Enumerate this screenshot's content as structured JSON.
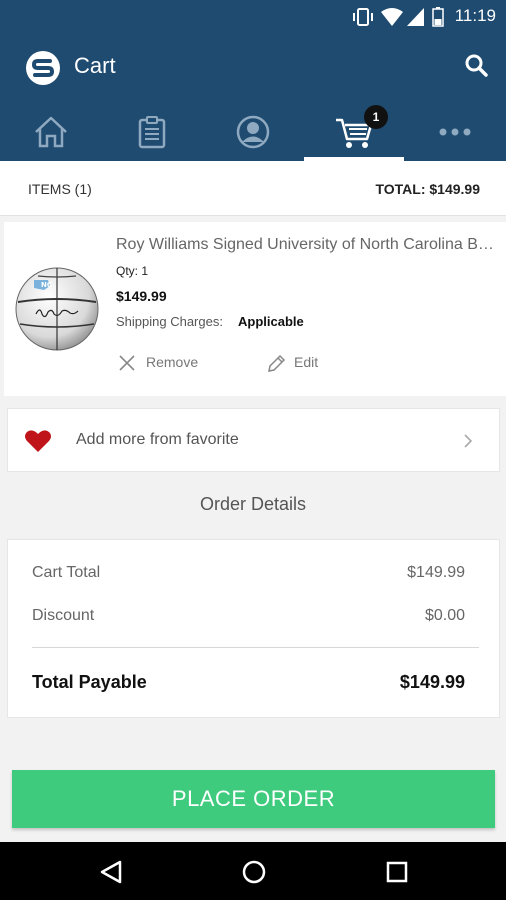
{
  "status_bar": {
    "time": "11:19"
  },
  "header": {
    "title": "Cart",
    "cart_badge": "1"
  },
  "nav": {
    "items": [
      "home",
      "orders",
      "profile",
      "cart",
      "more"
    ],
    "active": "cart"
  },
  "summary": {
    "items_label": "ITEMS (1)",
    "total_label": "TOTAL: $149.99"
  },
  "product": {
    "name": "Roy Williams Signed University of North Carolina Basketball",
    "qty": "Qty: 1",
    "price": "$149.99",
    "shipping_label": "Shipping Charges:",
    "shipping_value": "Applicable",
    "remove_label": "Remove",
    "edit_label": "Edit"
  },
  "favorite": {
    "label": "Add more from favorite"
  },
  "order_details": {
    "title": "Order Details",
    "cart_total_label": "Cart Total",
    "cart_total_value": "$149.99",
    "discount_label": "Discount",
    "discount_value": "$0.00",
    "total_payable_label": "Total Payable",
    "total_payable_value": "$149.99"
  },
  "place_order_label": "PLACE ORDER",
  "colors": {
    "header": "#1f4b70",
    "accent_green": "#3ecb7d",
    "heart": "#c0141b"
  }
}
